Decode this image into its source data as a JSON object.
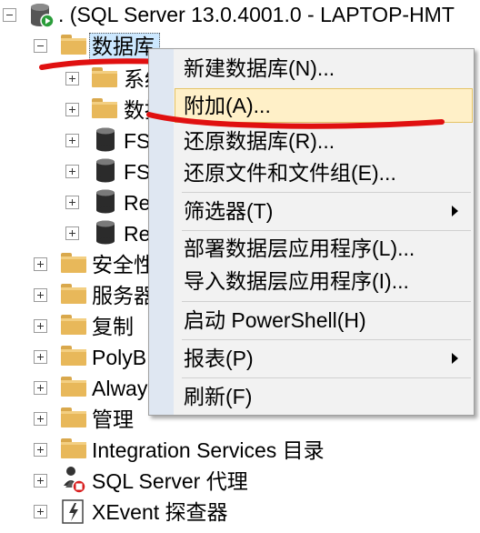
{
  "tree": {
    "server_label": ". (SQL Server 13.0.4001.0 - LAPTOP-HMT",
    "databases_label": "数据库",
    "db_children": [
      "系统",
      "数据",
      "FS",
      "FS",
      "Re",
      "Re"
    ],
    "top_items": [
      "安全性",
      "服务器",
      "复制",
      "PolyB",
      "Alway",
      "管理",
      "Integration Services 目录"
    ],
    "agent_label": "SQL Server 代理",
    "xevent_label": "XEvent 探查器"
  },
  "context_menu": {
    "items": [
      {
        "label": "新建数据库(N)...",
        "submenu": false
      },
      {
        "label": "附加(A)...",
        "submenu": false,
        "highlighted": true
      },
      {
        "label": "还原数据库(R)...",
        "submenu": false
      },
      {
        "label": "还原文件和文件组(E)...",
        "submenu": false
      },
      {
        "label": "筛选器(T)",
        "submenu": true
      },
      {
        "label": "部署数据层应用程序(L)...",
        "submenu": false
      },
      {
        "label": "导入数据层应用程序(I)...",
        "submenu": false
      },
      {
        "label": "启动 PowerShell(H)",
        "submenu": false
      },
      {
        "label": "报表(P)",
        "submenu": true
      },
      {
        "label": "刷新(F)",
        "submenu": false
      }
    ]
  },
  "colors": {
    "annotation_red": "#e01010",
    "selection": "#cce8ff",
    "menu_highlight": "#fff0c8",
    "folder": "#e8b85a"
  }
}
